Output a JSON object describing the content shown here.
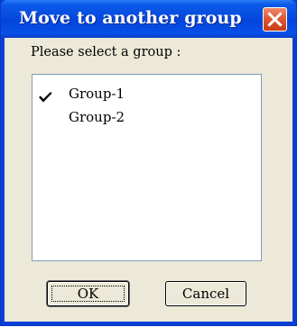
{
  "window": {
    "title": "Move to another group"
  },
  "dialog": {
    "prompt": "Please select a group :",
    "groups": [
      {
        "label": "Group-1",
        "checked": true
      },
      {
        "label": "Group-2",
        "checked": false
      }
    ],
    "ok_label": "OK",
    "cancel_label": "Cancel"
  },
  "icons": {
    "close": "close-icon",
    "check": "checkmark-icon"
  },
  "colors": {
    "titlebar": "#0445dc",
    "close_button": "#e05a36",
    "dialog_face": "#ece9d8",
    "listbox_border": "#7f9db9"
  }
}
